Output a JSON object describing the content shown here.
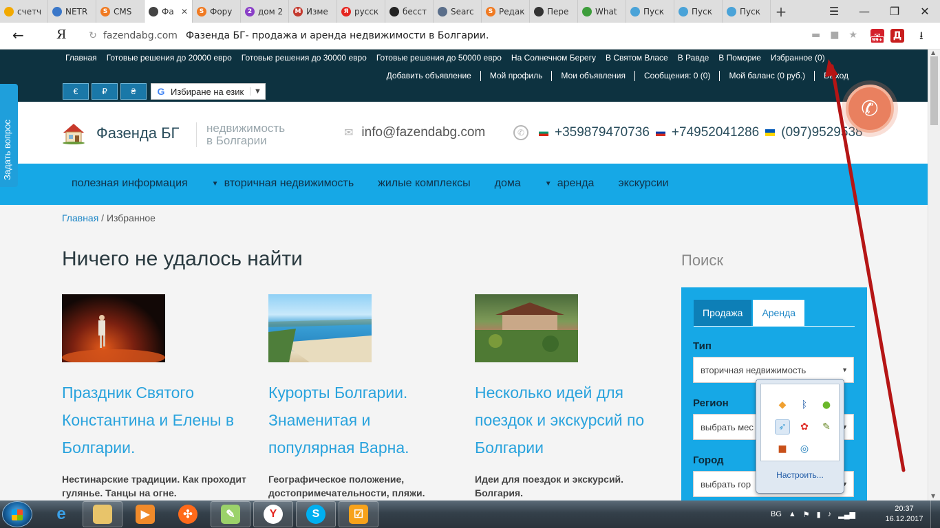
{
  "browser": {
    "tabs": [
      {
        "title": "счетч",
        "fav_color": "#f2a900",
        "fav_text": ""
      },
      {
        "title": "NETR",
        "fav_color": "#3a77c9",
        "fav_text": ""
      },
      {
        "title": "CMS",
        "fav_color": "#f07a22",
        "fav_text": "S"
      },
      {
        "title": "Фа",
        "fav_color": "#444444",
        "fav_text": "",
        "active": true
      },
      {
        "title": "Фору",
        "fav_color": "#f07a22",
        "fav_text": "S"
      },
      {
        "title": "дом 2",
        "fav_color": "#8a3fc7",
        "fav_text": "2"
      },
      {
        "title": "Изме",
        "fav_color": "#c43a2f",
        "fav_text": "M"
      },
      {
        "title": "русск",
        "fav_color": "#e52620",
        "fav_text": "Я"
      },
      {
        "title": "бесст",
        "fav_color": "#222222",
        "fav_text": ""
      },
      {
        "title": "Searc",
        "fav_color": "#5a6e8a",
        "fav_text": ""
      },
      {
        "title": "Редак",
        "fav_color": "#f07a22",
        "fav_text": "S"
      },
      {
        "title": "Пере",
        "fav_color": "#333333",
        "fav_text": ""
      },
      {
        "title": "What",
        "fav_color": "#3d9d3b",
        "fav_text": ""
      },
      {
        "title": "Пуск",
        "fav_color": "#4aa3d8",
        "fav_text": ""
      },
      {
        "title": "Пуск",
        "fav_color": "#4aa3d8",
        "fav_text": ""
      },
      {
        "title": "Пуск",
        "fav_color": "#4aa3d8",
        "fav_text": ""
      }
    ],
    "close_glyph": "✕",
    "new_tab": "+",
    "window_controls": [
      "☰",
      "—",
      "❐",
      "✕"
    ],
    "back": "←",
    "ya_logo": "Я",
    "domain": "fazendabg.com",
    "page_title": "Фазенда БГ- продажа и аренда недвижимости в Болгарии.",
    "ext1_badge": "99+",
    "ext2_label": "Д"
  },
  "site": {
    "top_links": [
      "Главная",
      "Готовые решения до 20000 евро",
      "Готовые решения до 30000 евро",
      "Готовые решения до 50000 евро",
      "На Солнечном Берегу",
      "В Святом Власе",
      "В Равде",
      "В Поморие",
      "Избранное (0)"
    ],
    "user_links": [
      "Добавить объявление",
      "Мой профиль",
      "Мои объявления",
      "Сообщения: 0 (0)",
      "Мой баланс (0 руб.)",
      "Выход"
    ],
    "currencies": [
      "€",
      "₽",
      "₴"
    ],
    "lang_selector": "Избиране на език",
    "brand": "Фазенда БГ",
    "tagline_1": "недвижимость",
    "tagline_2": "в Болгарии",
    "email": "info@fazendabg.com",
    "phone_bg": "+359879470736",
    "phone_ru": "+74952041286",
    "phone_ua": "(097)9529538",
    "side_tab": "Задать вопрос",
    "nav": [
      {
        "label": "полезная информация",
        "dropdown": false
      },
      {
        "label": "вторичная недвижимость",
        "dropdown": true
      },
      {
        "label": "жилые комплексы",
        "dropdown": false
      },
      {
        "label": "дома",
        "dropdown": false
      },
      {
        "label": "аренда",
        "dropdown": true
      },
      {
        "label": "экскурсии",
        "dropdown": false
      }
    ],
    "breadcrumb_home": "Главная",
    "breadcrumb_sep": " / ",
    "breadcrumb_current": "Избранное",
    "heading": "Ничего не удалось найти",
    "cards": [
      {
        "title": "Праздник Святого Константина и Елены в Болгарии.",
        "desc": "Нестинарские традиции. Как проходит гулянье. Танцы на огне."
      },
      {
        "title": "Курорты Болгарии. Знаменитая и популярная Варна.",
        "desc": "Географическое положение, достопримечательности, пляжи."
      },
      {
        "title": "Несколько идей для поездок и экскурсий по Болгарии",
        "desc": "Идеи для поездок и экскурсий. Болгария."
      }
    ],
    "search": {
      "heading": "Поиск",
      "tab_sale": "Продажа",
      "tab_rent": "Аренда",
      "type_label": "Тип",
      "type_value": "вторичная недвижимость",
      "region_label": "Регион",
      "region_value": "выбрать мес",
      "city_label": "Город",
      "city_value": "выбрать гор"
    }
  },
  "tray_popup": {
    "configure": "Настроить..."
  },
  "taskbar": {
    "lang": "BG",
    "time": "20:37",
    "date": "16.12.2017"
  }
}
